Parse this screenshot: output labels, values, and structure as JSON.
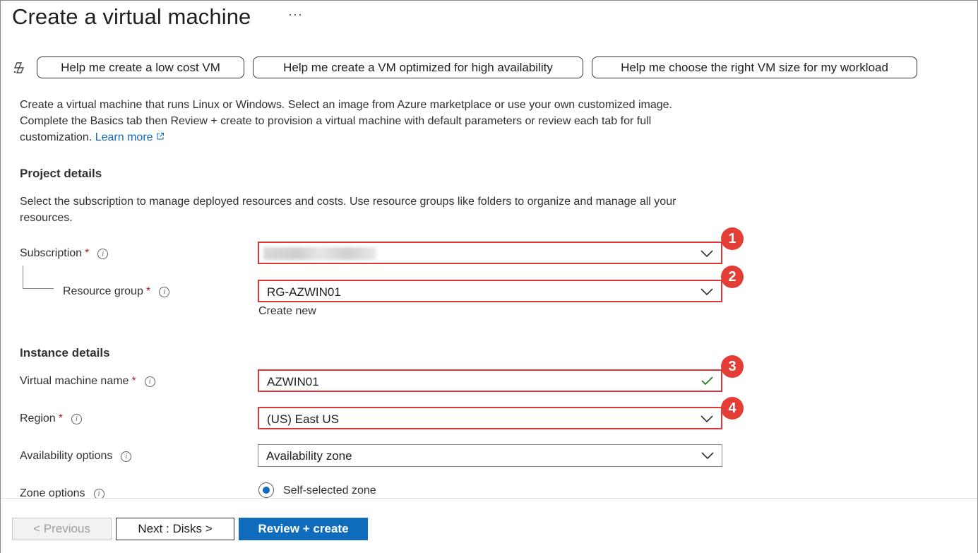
{
  "header": {
    "title": "Create a virtual machine",
    "more_label": "···"
  },
  "copilot_prompts": [
    "Help me create a low cost VM",
    "Help me create a VM optimized for high availability",
    "Help me choose the right VM size for my workload"
  ],
  "intro": {
    "text": "Create a virtual machine that runs Linux or Windows. Select an image from Azure marketplace or use your own customized image. Complete the Basics tab then Review + create to provision a virtual machine with default parameters or review each tab for full customization.",
    "learn_more": "Learn more"
  },
  "project_details": {
    "heading": "Project details",
    "description": "Select the subscription to manage deployed resources and costs. Use resource groups like folders to organize and manage all your resources.",
    "subscription_label": "Subscription",
    "subscription_value": "",
    "resource_group_label": "Resource group",
    "resource_group_value": "RG-AZWIN01",
    "create_new": "Create new"
  },
  "instance_details": {
    "heading": "Instance details",
    "vm_name_label": "Virtual machine name",
    "vm_name_value": "AZWIN01",
    "region_label": "Region",
    "region_value": "(US) East US",
    "availability_label": "Availability options",
    "availability_value": "Availability zone",
    "zone_label": "Zone options",
    "zone_value": "Self-selected zone"
  },
  "required_marker": "*",
  "annotations": [
    "1",
    "2",
    "3",
    "4"
  ],
  "footer": {
    "previous": "< Previous",
    "next": "Next : Disks >",
    "review": "Review + create"
  },
  "colors": {
    "accent": "#0f6cbd",
    "highlight": "#e0343b",
    "badge": "#e43d36",
    "required": "#a4262c",
    "valid": "#107c10"
  }
}
